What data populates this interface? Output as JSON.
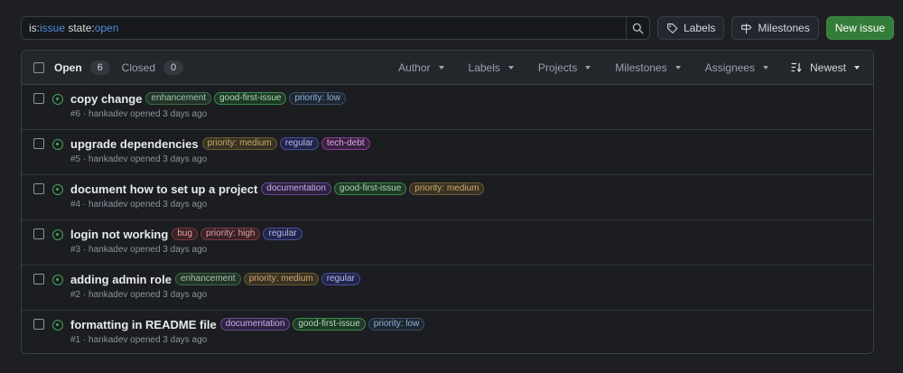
{
  "search": {
    "query_parts": [
      {
        "text": "is:",
        "highlight": false
      },
      {
        "text": "issue",
        "highlight": true
      },
      {
        "text": " state:",
        "highlight": false
      },
      {
        "text": "open",
        "highlight": true
      }
    ]
  },
  "toolbar": {
    "labels_label": "Labels",
    "milestones_label": "Milestones",
    "new_issue_label": "New issue"
  },
  "header": {
    "open_label": "Open",
    "open_count": "6",
    "closed_label": "Closed",
    "closed_count": "0",
    "filters": [
      "Author",
      "Labels",
      "Projects",
      "Milestones",
      "Assignees"
    ],
    "sort_label": "Newest"
  },
  "label_colors": {
    "enhancement": {
      "bg": "#23342a",
      "border": "#3d6b47",
      "text": "#9fc7a8"
    },
    "good-first-issue": {
      "bg": "#1f3a26",
      "border": "#3b8a4c",
      "text": "#a9dcb2"
    },
    "priority: low": {
      "bg": "#1d2732",
      "border": "#3a5068",
      "text": "#8fb2d6"
    },
    "priority: medium": {
      "bg": "#3a3222",
      "border": "#6b5a34",
      "text": "#c9a96e"
    },
    "priority: high": {
      "bg": "#3a2226",
      "border": "#7a3a42",
      "text": "#e59aa2"
    },
    "regular": {
      "bg": "#22254a",
      "border": "#4a4f9a",
      "text": "#b4b8f0"
    },
    "tech-debt": {
      "bg": "#3a2040",
      "border": "#8a3f99",
      "text": "#e2a8ec"
    },
    "documentation": {
      "bg": "#2e2240",
      "border": "#6a4a94",
      "text": "#c6aef0"
    },
    "bug": {
      "bg": "#3a2124",
      "border": "#7a3a40",
      "text": "#e8a0a6"
    }
  },
  "issues": [
    {
      "title": "copy change",
      "labels": [
        "enhancement",
        "good-first-issue",
        "priority: low"
      ],
      "meta": "#6 · hankadev opened 3 days ago"
    },
    {
      "title": "upgrade dependencies",
      "labels": [
        "priority: medium",
        "regular",
        "tech-debt"
      ],
      "meta": "#5 · hankadev opened 3 days ago"
    },
    {
      "title": "document how to set up a project",
      "labels": [
        "documentation",
        "good-first-issue",
        "priority: medium"
      ],
      "meta": "#4 · hankadev opened 3 days ago"
    },
    {
      "title": "login not working",
      "labels": [
        "bug",
        "priority: high",
        "regular"
      ],
      "meta": "#3 · hankadev opened 3 days ago"
    },
    {
      "title": "adding admin role",
      "labels": [
        "enhancement",
        "priority: medium",
        "regular"
      ],
      "meta": "#2 · hankadev opened 3 days ago"
    },
    {
      "title": "formatting in README file",
      "labels": [
        "documentation",
        "good-first-issue",
        "priority: low"
      ],
      "meta": "#1 · hankadev opened 3 days ago"
    }
  ]
}
